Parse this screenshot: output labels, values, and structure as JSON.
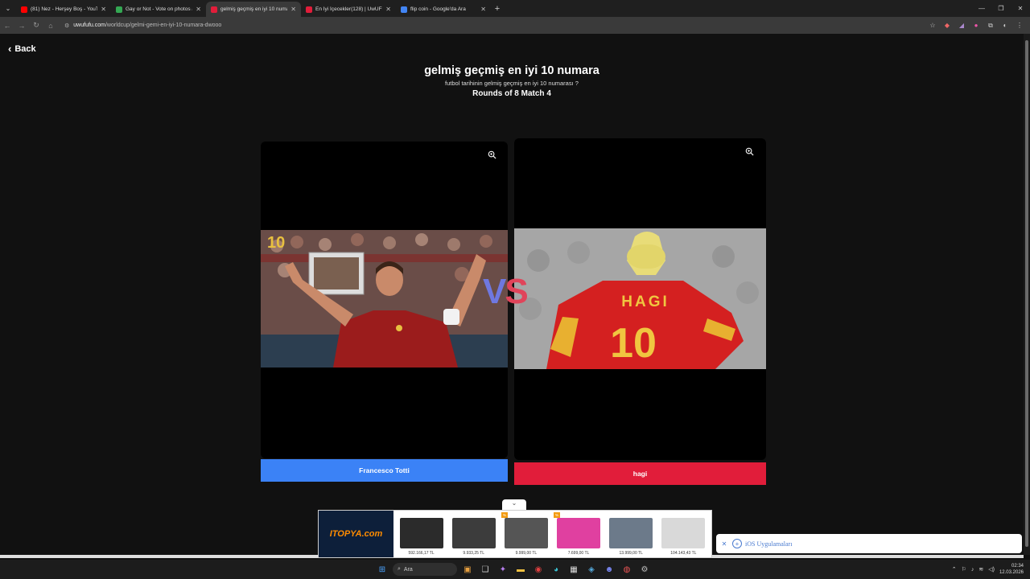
{
  "browser": {
    "tabs": [
      {
        "label": "(81) Nez - Herşey Boş - YouTube",
        "favicon_color": "#ff0000",
        "active": false
      },
      {
        "label": "Gay or Not - Vote on photos and...",
        "favicon_color": "#34a853",
        "active": false
      },
      {
        "label": "gelmiş geçmiş en iyi 10 numara",
        "favicon_color": "#e11d3a",
        "active": true
      },
      {
        "label": "En İyi İçecekler(128) | UwUFUFU",
        "favicon_color": "#e11d3a",
        "active": false
      },
      {
        "label": "flip coin - Google'da Ara",
        "favicon_color": "#4285f4",
        "active": false
      }
    ],
    "url_host": "uwufufu.com",
    "url_path": "/worldcup/gelmi-gemi-en-iyi-10-numara-dwooo"
  },
  "page": {
    "back_label": "Back",
    "title": "gelmiş geçmiş en iyi 10 numara",
    "subtitle": "futbol tarihinin gelmiş geçmiş en iyi 10 numarası ?",
    "rounds": "Rounds of 8 Match 4",
    "vs_v": "V",
    "vs_s": "S",
    "left_choice": "Francesco Totti",
    "right_choice": "hagi",
    "left_jersey_text": "10",
    "right_jersey_name": "HAGI",
    "right_jersey_number": "10"
  },
  "ad": {
    "logo": "ITOPYA.com",
    "items": [
      {
        "price": "592.166,17 TL",
        "color": "#2b2b2b",
        "badge": ""
      },
      {
        "price": "9.933,25 TL",
        "color": "#3c3c3c",
        "badge": ""
      },
      {
        "price": "9.999,00 TL",
        "color": "#555555",
        "badge": "%"
      },
      {
        "price": "7.699,00 TL",
        "color": "#e040a0",
        "badge": "%"
      },
      {
        "price": "13.999,00 TL",
        "color": "#6c7a8a",
        "badge": ""
      },
      {
        "price": "104.143,43 TL",
        "color": "#d9d9d9",
        "badge": ""
      }
    ]
  },
  "toast": {
    "label": "iOS Uygulamaları"
  },
  "taskbar": {
    "search": "Ara",
    "time": "02:34",
    "date": "12.03.2026"
  },
  "colors": {
    "left_button": "#3b82f6",
    "right_button": "#e11d3a",
    "vs_blue": "#6f78e0",
    "vs_red": "#e0445a"
  }
}
